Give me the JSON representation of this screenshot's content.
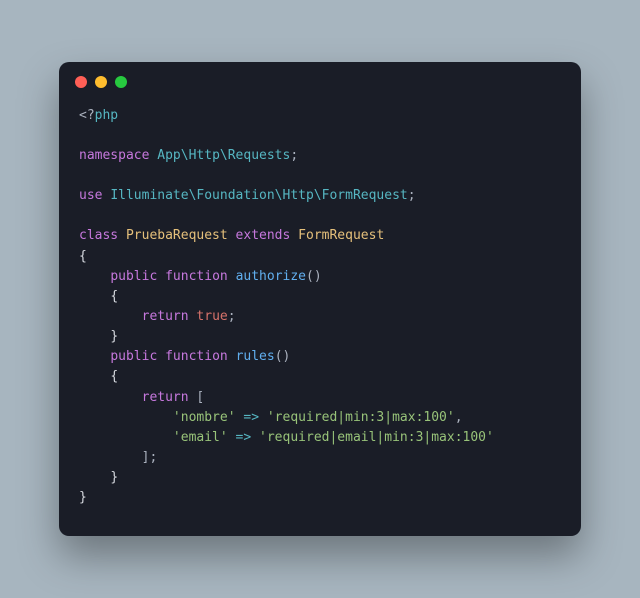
{
  "titlebar": {
    "dots": [
      "red",
      "yellow",
      "green"
    ]
  },
  "code": {
    "open_tag_lt": "<?",
    "open_tag_php": "php",
    "namespace_kw": "namespace",
    "namespace_path": "App\\Http\\Requests",
    "use_kw": "use",
    "use_path": "Illuminate\\Foundation\\Http\\FormRequest",
    "class_kw": "class",
    "class_name": "PruebaRequest",
    "extends_kw": "extends",
    "parent_class": "FormRequest",
    "public_kw": "public",
    "function_kw": "function",
    "method_authorize": "authorize",
    "method_rules": "rules",
    "return_kw": "return",
    "true_lit": "true",
    "arrow": "=>",
    "rule_key_nombre": "'nombre'",
    "rule_val_nombre": "'required|min:3|max:100'",
    "rule_key_email": "'email'",
    "rule_val_email": "'required|email|min:3|max:100'",
    "semi": ";",
    "comma": ",",
    "lparen": "(",
    "rparen": ")",
    "lbrace": "{",
    "rbrace": "}",
    "lbracket": "[",
    "rbracket": "]"
  }
}
